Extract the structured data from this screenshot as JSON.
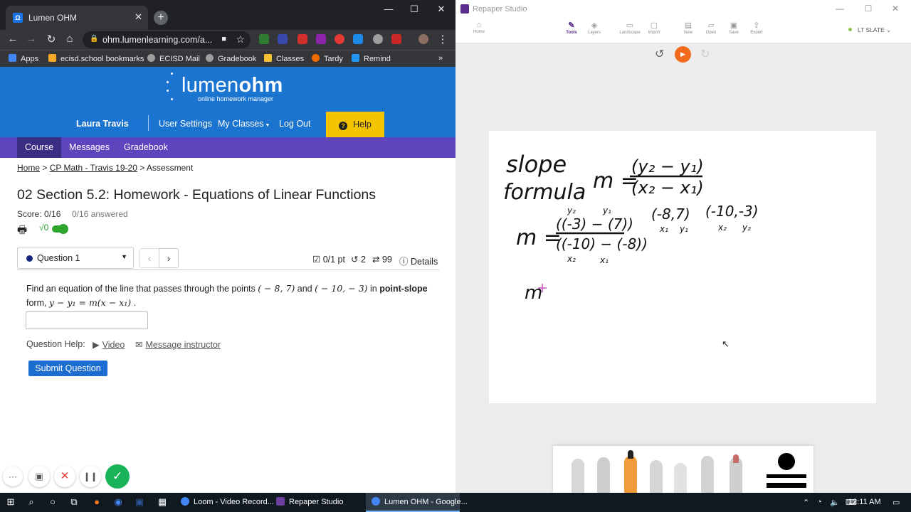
{
  "browser": {
    "tab_title": "Lumen OHM",
    "url": "ohm.lumenlearning.com/a...",
    "bookmarks": [
      "Apps",
      "ecisd.school bookmarks",
      "ECISD Mail",
      "Gradebook",
      "Classes",
      "Tardy",
      "Remind"
    ]
  },
  "lumen": {
    "logo_main": "lumen",
    "logo_bold": "ohm",
    "logo_sub": "online homework manager",
    "user": "Laura Travis",
    "nav": [
      "User Settings",
      "My Classes",
      "Log Out"
    ],
    "help": "Help",
    "tabs": [
      "Course",
      "Messages",
      "Gradebook"
    ],
    "breadcrumb": {
      "home": "Home",
      "course": "CP Math - Travis 19-20",
      "current": "Assessment",
      "sep": ">"
    },
    "assessment_title": "02 Section 5.2: Homework - Equations of Linear Functions",
    "score": "Score: 0/16",
    "answered": "0/16 answered",
    "math_toggle": "√0",
    "question_select": "Question 1",
    "points": "0/1 pt",
    "retries": "2",
    "attempts": "99",
    "details": "Details",
    "question": {
      "pre": "Find an equation of the line that passes through the points",
      "p1": "( − 8, 7)",
      "and": "and",
      "p2": "( − 10,  − 3)",
      "in": "in",
      "bold": "point-slope",
      "form": "form,",
      "formula": "y − y₁ = m(x − x₁)",
      "end": "."
    },
    "question_help": "Question Help:",
    "video": "Video",
    "message": "Message instructor",
    "submit": "Submit Question"
  },
  "loom": {
    "more": "···",
    "check": "✓"
  },
  "repaper": {
    "title": "Repaper Studio",
    "tools": [
      "Home",
      "Tools",
      "Layers",
      "Landscape",
      "Import",
      "New",
      "Open",
      "Save",
      "Export"
    ],
    "active_tool": "Tools",
    "theme": "LT SLATE",
    "handwriting": {
      "slope": "slope",
      "formula": "formula",
      "m_eq": "m =",
      "num_top": "(y₂ − y₁)",
      "den_top": "(x₂ − x₁)",
      "num": "((-3) − (7))",
      "den": "((-10) − (-8))",
      "label_y2": "y₂",
      "label_y1": "y₁",
      "label_x2": "x₂",
      "label_x1": "x₁",
      "pt1": "(-8,7)",
      "pt2": "(-10,-3)",
      "m_partial": "m"
    }
  },
  "taskbar": {
    "apps": [
      "Loom - Video Record...",
      "Repaper Studio",
      "Lumen OHM - Google..."
    ],
    "time": "12:11 AM"
  }
}
